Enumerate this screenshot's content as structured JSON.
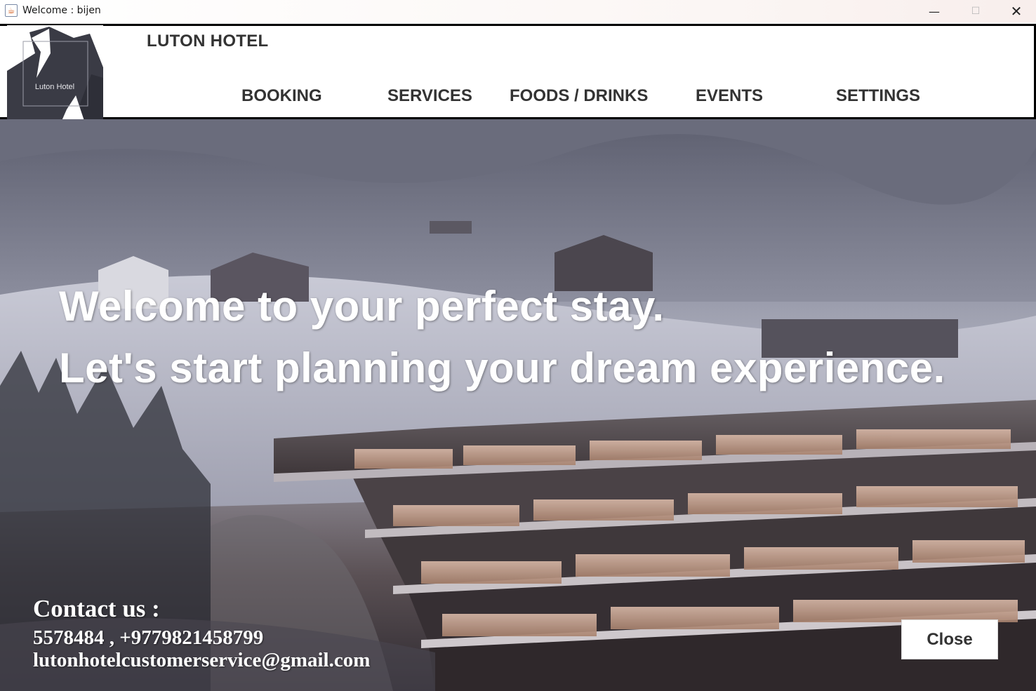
{
  "window": {
    "title": "Welcome : bijen",
    "icon": "java-cup-icon",
    "controls": {
      "minimize": "—",
      "maximize": "☐",
      "close": "✕"
    }
  },
  "header": {
    "logo_text": "Luton Hotel",
    "hotel_name": "LUTON HOTEL",
    "nav": {
      "booking": "BOOKING",
      "services": "SERVICES",
      "foods": "FOODS / DRINKS",
      "events": "EVENTS",
      "settings": "SETTINGS"
    }
  },
  "hero": {
    "line1": "Welcome to your perfect stay.",
    "line2": "Let's start planning your dream experience."
  },
  "contact": {
    "title": "Contact us :",
    "phone": "5578484 , +9779821458799",
    "email": "lutonhotelcustomerservice@gmail.com"
  },
  "buttons": {
    "close": "Close"
  },
  "colors": {
    "header_bg": "#ffffff",
    "header_border": "#000000",
    "nav_text": "#333333",
    "logo_bg": "#3a3b45",
    "hero_text": "#ffffff"
  }
}
